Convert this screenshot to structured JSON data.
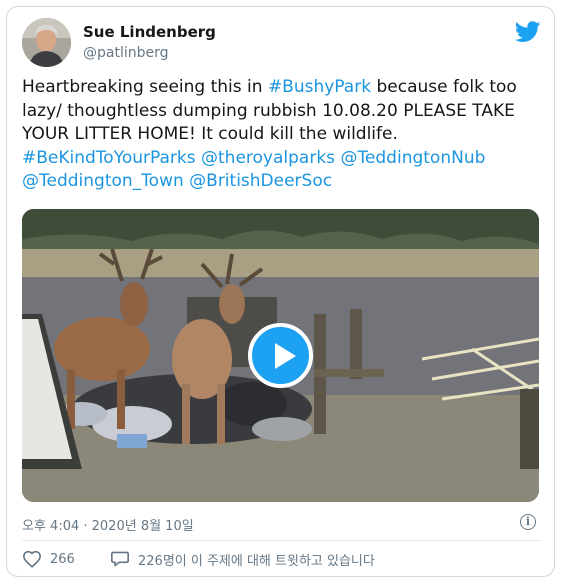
{
  "user": {
    "name": "Sue Lindenberg",
    "handle": "@patlinberg"
  },
  "tweet": {
    "t1": "Heartbreaking seeing this in ",
    "h1": "#BushyPark",
    "t2": " because folk too lazy/ thoughtless dumping rubbish 10.08.20 PLEASE TAKE YOUR LITTER HOME! It could kill the wildlife. ",
    "h2": "#BeKindToYourParks",
    "t3": " ",
    "h3": "@theroyalparks",
    "t4": " ",
    "h4": "@TeddingtonNub",
    "t5": " ",
    "h5": "@Teddington_Town",
    "t6": " ",
    "h6": "@BritishDeerSoc"
  },
  "meta": {
    "timestamp": "오후 4:04 · 2020년 8월 10일"
  },
  "actions": {
    "likes": "266",
    "talking": "226명이 이 주제에 대해 트윗하고 있습니다"
  },
  "icons": {
    "brand": "twitter-bird-icon",
    "like": "heart-icon",
    "reply": "speech-bubble-icon",
    "info": "info-icon",
    "play": "play-icon"
  },
  "colors": {
    "accent": "#1da1f2",
    "link": "#1b95e0",
    "muted": "#657786",
    "border": "#cfd9de"
  }
}
